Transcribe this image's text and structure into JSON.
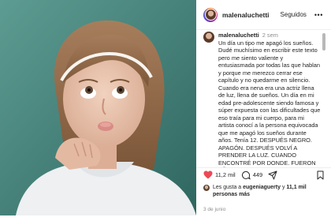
{
  "header": {
    "username": "malenaluchetti",
    "follow_label": "Seguidos",
    "more_label": "•••"
  },
  "caption": {
    "username": "malenaluchetti",
    "time": "2 sem",
    "text": "Un día un tipo me apagó los sueños. Dudé muchísimo en escribir este texto pero me siento valiente y entusiasmada por todas las que hablan y porque me merezco cerrar ese capítulo y no quedarme en silencio. Cuando era nena era una actriz llena de luz, llena de sueños. Un día en mi edad pre-adolescente siendo famosa y súper expuesta con las dificultades que eso traía para mi cuerpo, para mi artista conocí a la persona equivocada que me apagó los sueños durante años. Tenía 12. DESPUÉS NEGRO. APAGÓN. DESPUÉS VOLVÍ A PRENDER LA LUZ. CUANDO ENCONTRÉ POR DONDE. FUERON AÑOS DE ENOJO, DE TRISTEZA Y DE MIEDO. MUCHO MIEDO Y"
  },
  "actions": {
    "likes_count": "11,2 mil",
    "comments_count": "449"
  },
  "likes_line": {
    "prefix": "Les gusta a ",
    "user": "eugeniaguerty",
    "middle": " y ",
    "others": "11,1 mil personas más"
  },
  "date": "3 de junio",
  "icons": {
    "like": "heart-icon",
    "comment": "comment-icon",
    "share": "share-icon",
    "save": "bookmark-icon"
  },
  "colors": {
    "photo_background": "#3f7a72",
    "like_red": "#ed4956",
    "text": "#262626",
    "muted": "#8e8e8e"
  }
}
